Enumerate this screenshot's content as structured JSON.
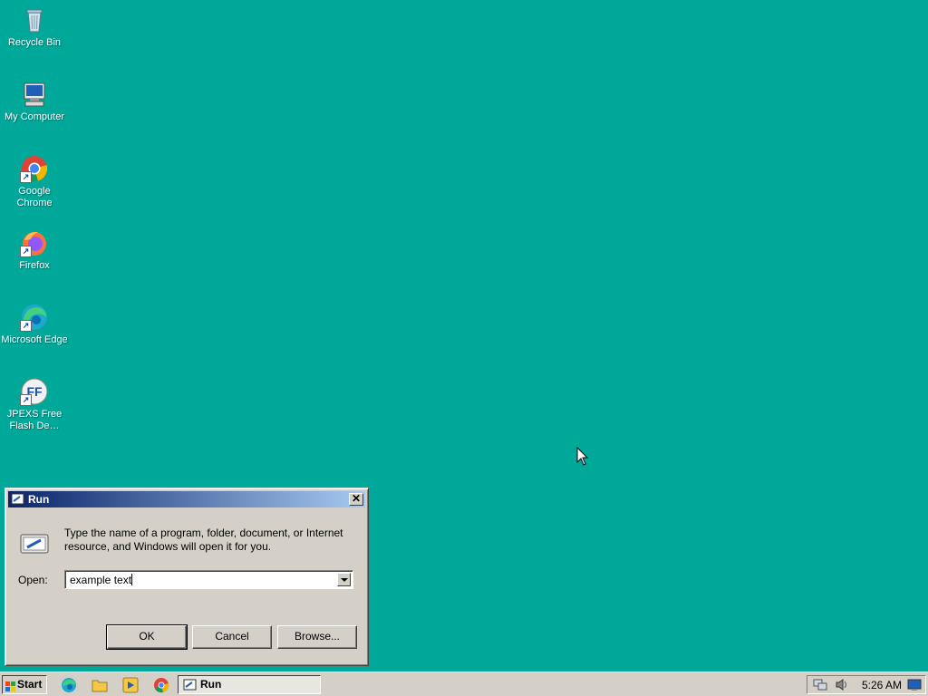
{
  "desktop": {
    "icons": [
      {
        "label": "Recycle Bin",
        "icon": "recycle-bin-icon"
      },
      {
        "label": "My Computer",
        "icon": "my-computer-icon"
      },
      {
        "label": "Google Chrome",
        "icon": "chrome-icon"
      },
      {
        "label": "Firefox",
        "icon": "firefox-icon"
      },
      {
        "label": "Microsoft Edge",
        "icon": "edge-icon"
      },
      {
        "label": "JPEXS Free Flash De…",
        "icon": "jpexs-icon"
      }
    ],
    "background": "#00a89a"
  },
  "run_dialog": {
    "title": "Run",
    "description": "Type the name of a program, folder, document, or Internet resource, and Windows will open it for you.",
    "open_label": "Open:",
    "open_value": "example text",
    "ok_label": "OK",
    "cancel_label": "Cancel",
    "browse_label": "Browse...",
    "close_glyph": "✕"
  },
  "taskbar": {
    "start_label": "Start",
    "quick_launch": [
      "edge-icon",
      "explorer-icon",
      "media-player-icon",
      "chrome-icon"
    ],
    "active_task": "Run",
    "clock": "5:26 AM"
  },
  "colors": {
    "titlebar_start": "#0a246a",
    "titlebar_end": "#a6caf0",
    "window_face": "#d4d0c8"
  }
}
